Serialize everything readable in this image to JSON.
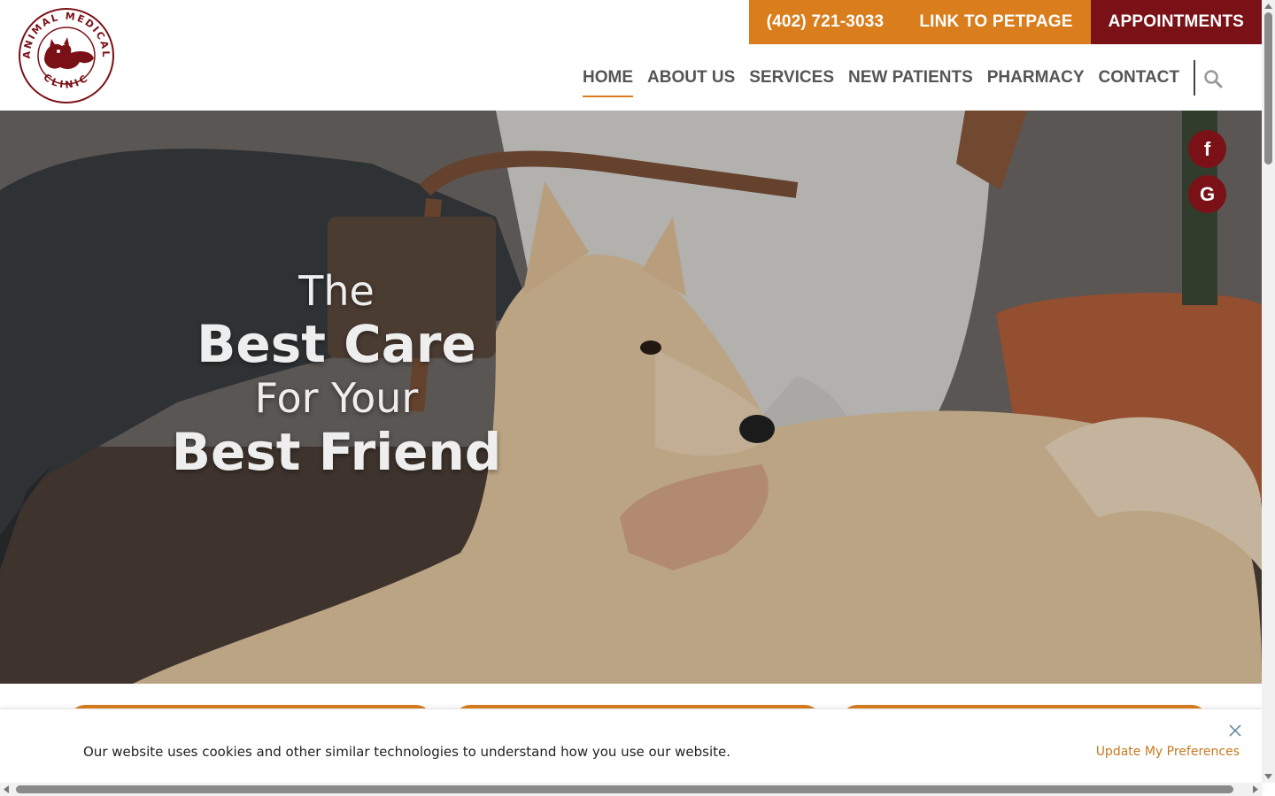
{
  "brand": {
    "logo_top_text": "ANIMAL MEDICAL",
    "logo_bottom_text": "CLINIC",
    "logo_color": "#7a1117"
  },
  "topbar": {
    "phone": "(402) 721-3033",
    "petpage": "LINK TO PETPAGE",
    "appointments": "APPOINTMENTS"
  },
  "nav": {
    "items": [
      "HOME",
      "ABOUT US",
      "SERVICES",
      "NEW PATIENTS",
      "PHARMACY",
      "CONTACT"
    ],
    "active": "HOME"
  },
  "hero": {
    "line1": "The",
    "line2": "Best Care",
    "line3": "For Your",
    "line4": "Best Friend"
  },
  "social": {
    "facebook": "f",
    "google": "G"
  },
  "cookie": {
    "message": "Our website uses cookies and other similar technologies to understand how you use our website.",
    "preferences": "Update My Preferences"
  },
  "colors": {
    "accent_orange": "#d97d1d",
    "accent_maroon": "#7a1117"
  }
}
